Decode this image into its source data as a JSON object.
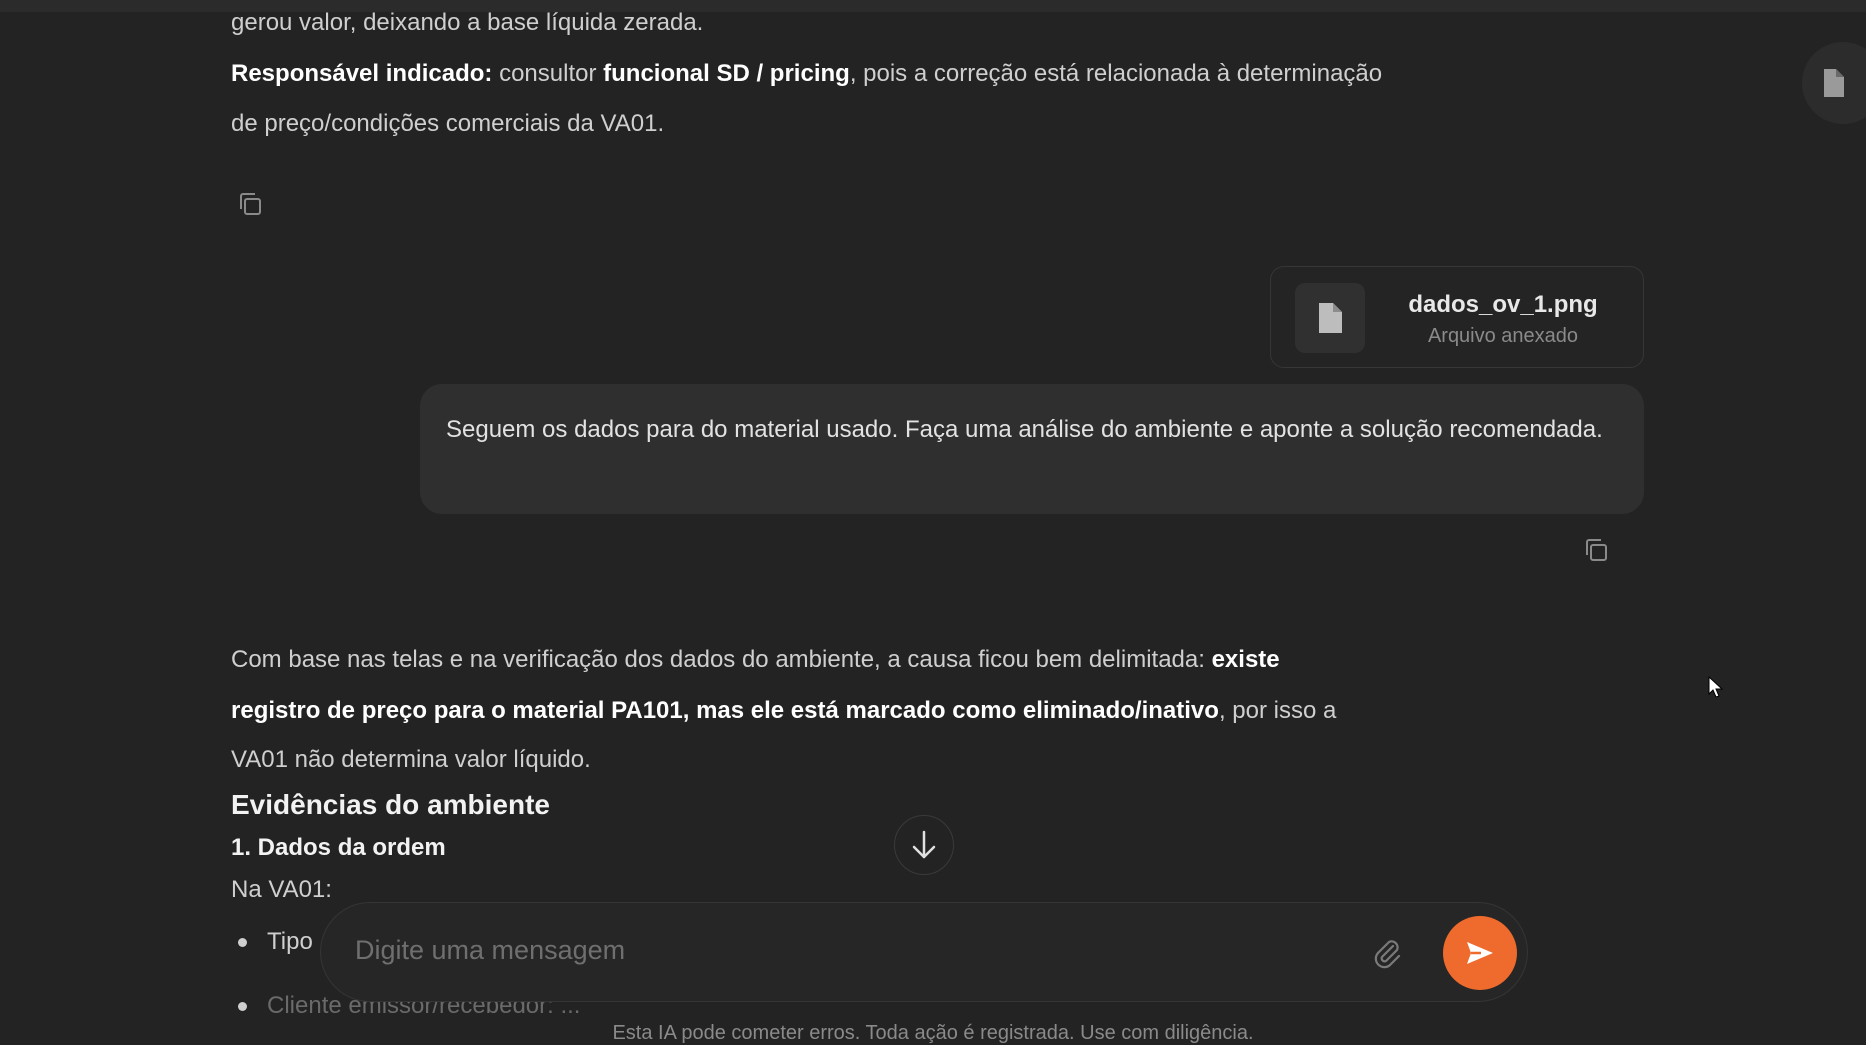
{
  "response1": {
    "line1": "gerou valor, deixando a base líquida zerada.",
    "responsavel_label": "Responsável indicado:",
    "responsavel_pre": " consultor ",
    "responsavel_bold": "funcional SD / pricing",
    "responsavel_post": ", pois a correção está relacionada à determinação",
    "line3": "de preço/condições comerciais da VA01."
  },
  "attachment": {
    "filename": "dados_ov_1.png",
    "subtitle": "Arquivo anexado"
  },
  "user_message": {
    "text": "Seguem os dados para do material usado. Faça uma análise do ambiente e aponte a solução recomendada."
  },
  "response2": {
    "intro_pre": "Com base nas telas e na verificação dos dados do ambiente, a causa ficou bem delimitada: ",
    "intro_bold_1": "existe",
    "intro_bold_2": "registro de preço para o material PA101, mas ele está marcado como eliminado/inativo",
    "intro_post": ", por isso a",
    "intro_line3": "VA01 não determina valor líquido.",
    "heading": "Evidências do ambiente",
    "subheading": "1. Dados da ordem",
    "na_va01": "Na VA01:",
    "bullets": [
      "Tipo",
      "Cliente emissor/recebedor: ..."
    ]
  },
  "composer": {
    "placeholder": "Digite uma mensagem"
  },
  "disclaimer": "Esta IA pode cometer erros. Toda ação é registrada. Use com diligência.",
  "colors": {
    "background": "#232323",
    "send_button": "#ee6a2d",
    "user_bubble": "#2f2f2f"
  },
  "icons": [
    "document-icon",
    "copy-icon",
    "file-icon",
    "arrow-down-icon",
    "paperclip-icon",
    "send-icon",
    "cursor-icon"
  ]
}
